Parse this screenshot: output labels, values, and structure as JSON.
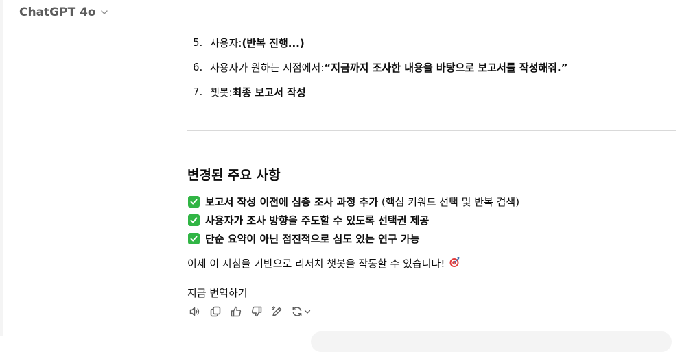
{
  "header": {
    "model_name": "ChatGPT 4o"
  },
  "steps": [
    {
      "number": "5.",
      "prefix": "사용자: ",
      "bold": "(반복 진행...)",
      "suffix": ""
    },
    {
      "number": "6.",
      "prefix": "사용자가 원하는 시점에서: ",
      "bold": "“지금까지 조사한 내용을 바탕으로 보고서를 작성해줘.”",
      "suffix": ""
    },
    {
      "number": "7.",
      "prefix": "챗봇: ",
      "bold": "최종 보고서 작성",
      "suffix": ""
    }
  ],
  "section": {
    "heading": "변경된 주요 사항",
    "items": [
      {
        "bold": "보고서 작성 이전에 심층 조사 과정 추가",
        "normal": " (핵심 키워드 선택 및 반복 검색)"
      },
      {
        "bold": "사용자가 조사 방향을 주도할 수 있도록 선택권 제공",
        "normal": ""
      },
      {
        "bold": "단순 요약이 아닌 점진적으로 심도 있는 연구 가능",
        "normal": ""
      }
    ],
    "closing": "이제 이 지침을 기반으로 리서치 챗봇을 작동할 수 있습니다!"
  },
  "translate_label": "지금 번역하기",
  "actions": [
    {
      "name": "read-aloud-button",
      "icon": "speaker-icon"
    },
    {
      "name": "copy-button",
      "icon": "copy-icon"
    },
    {
      "name": "good-response-button",
      "icon": "thumbs-up-icon"
    },
    {
      "name": "bad-response-button",
      "icon": "thumbs-down-icon"
    },
    {
      "name": "edit-in-canvas-button",
      "icon": "pen-icon"
    },
    {
      "name": "regenerate-button",
      "icon": "refresh-icon"
    }
  ],
  "colors": {
    "check_green": "#31b545",
    "icon_gray": "#5d5d5d",
    "target_red": "#e23b3b"
  }
}
